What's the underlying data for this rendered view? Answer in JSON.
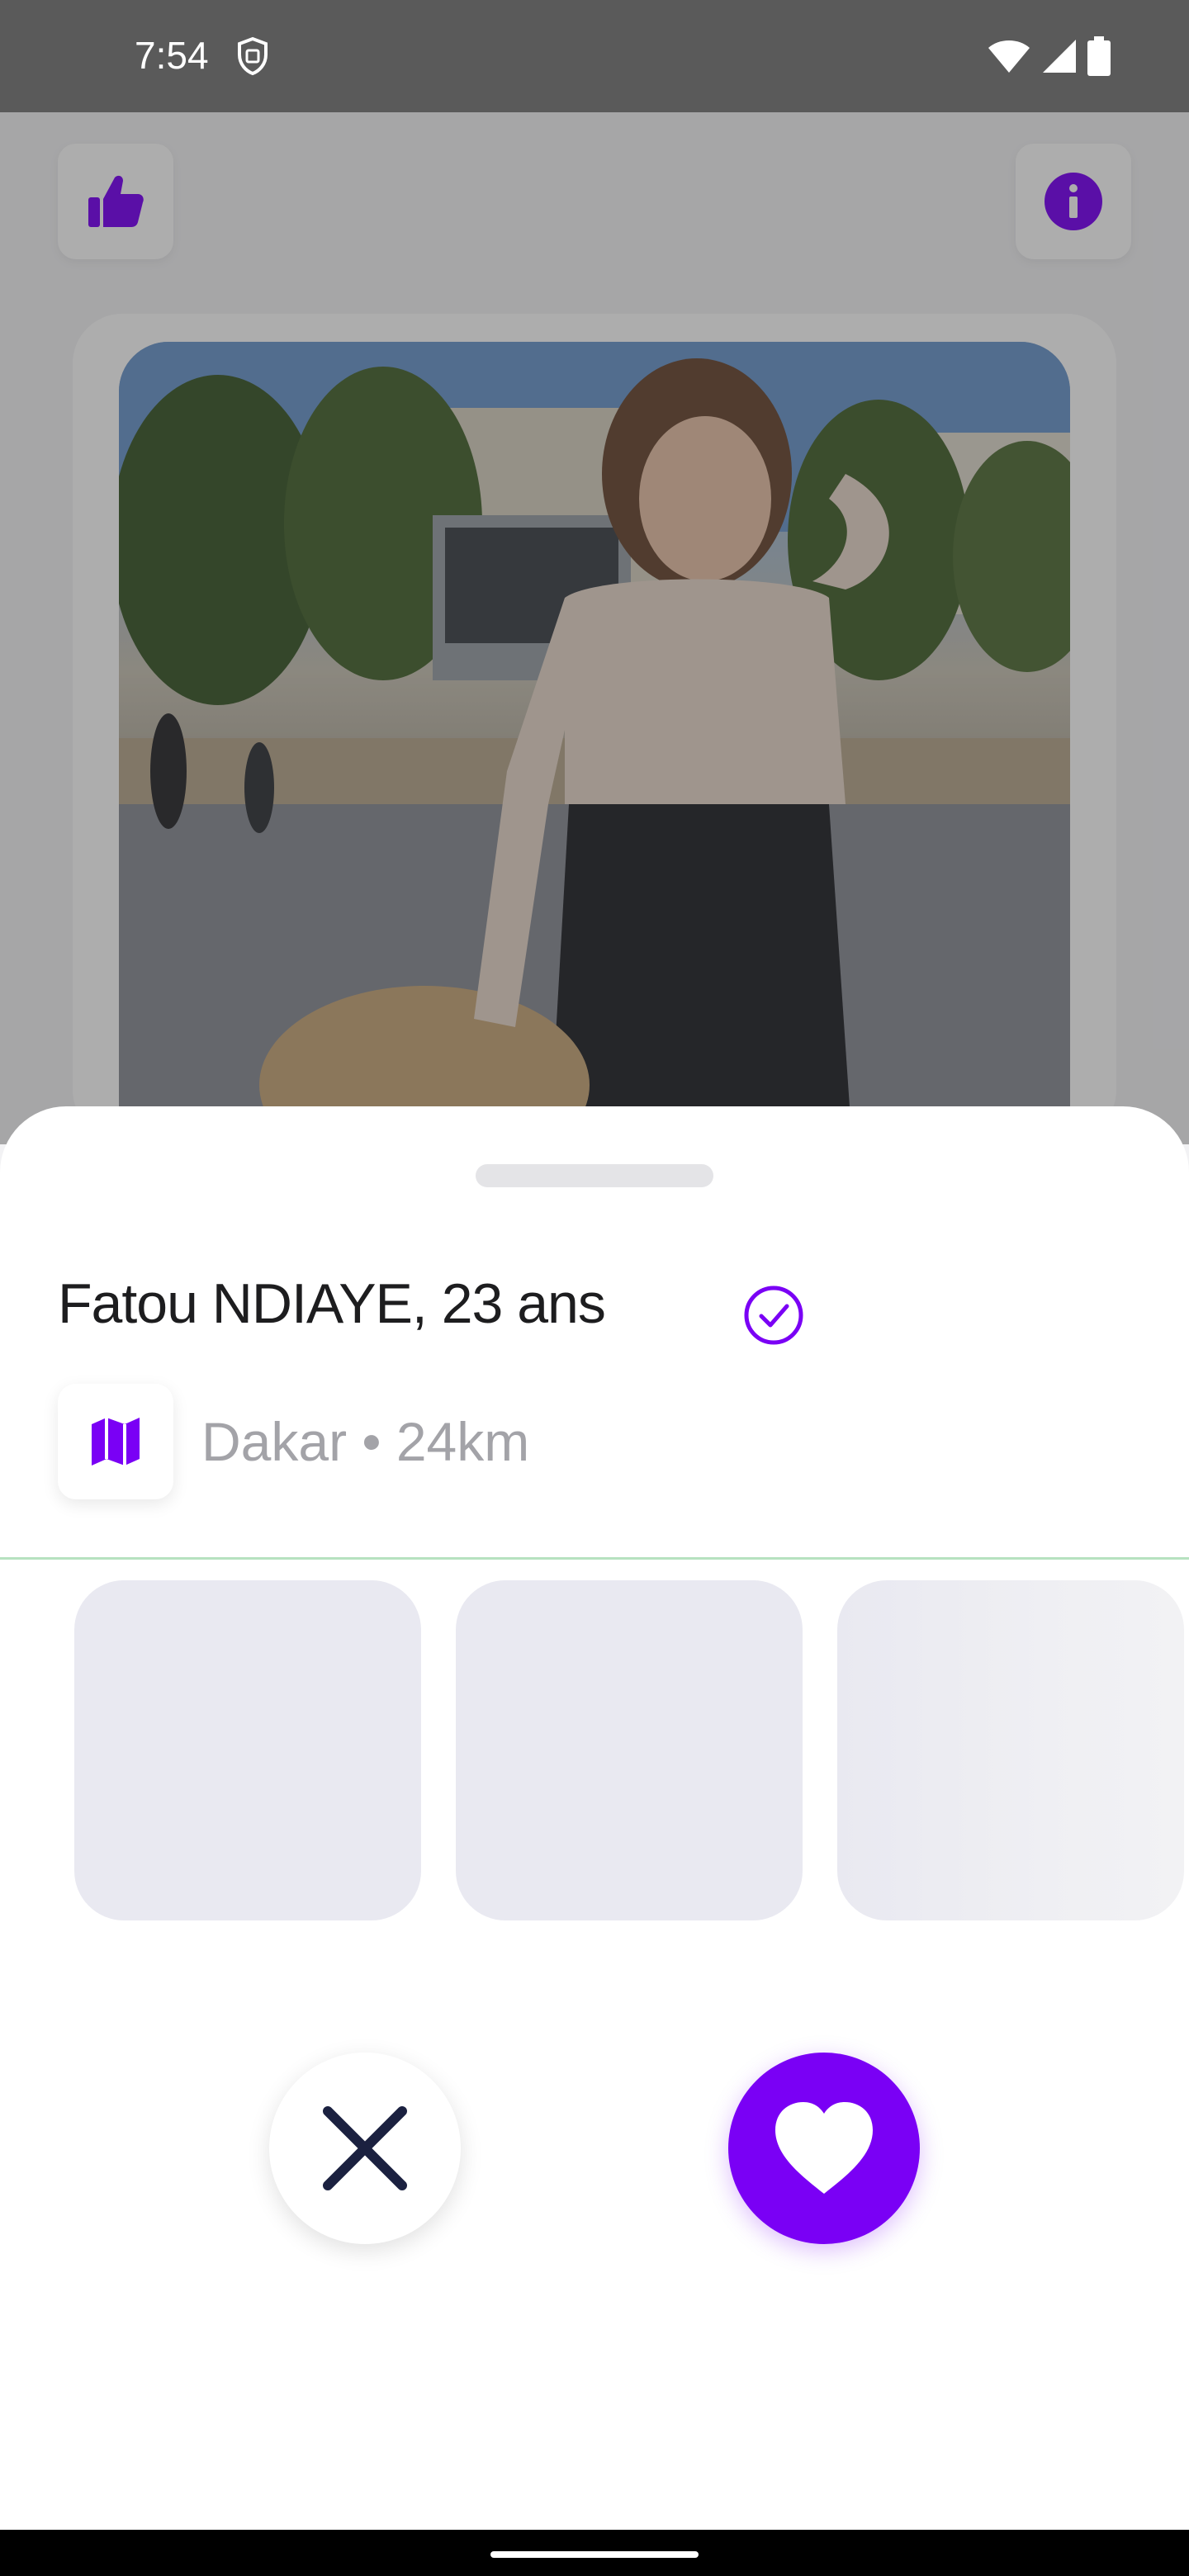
{
  "status_bar": {
    "time": "7:54",
    "icons": [
      "vpn-icon",
      "wifi-icon",
      "cell-signal-icon",
      "battery-icon"
    ]
  },
  "top_bar": {
    "left_icon": "thumbs-up-icon",
    "right_icon": "info-icon"
  },
  "profile": {
    "name_age": "Fatou NDIAYE, 23 ans",
    "verified_icon": "verified-check-icon",
    "location": "Dakar • 24km",
    "location_icon": "map-icon"
  },
  "actions": {
    "dislike_icon": "close-icon",
    "like_icon": "heart-icon"
  },
  "colors": {
    "accent": "#7a00f5",
    "dark_icon": "#1b2140",
    "divider": "#b7e2c0"
  }
}
